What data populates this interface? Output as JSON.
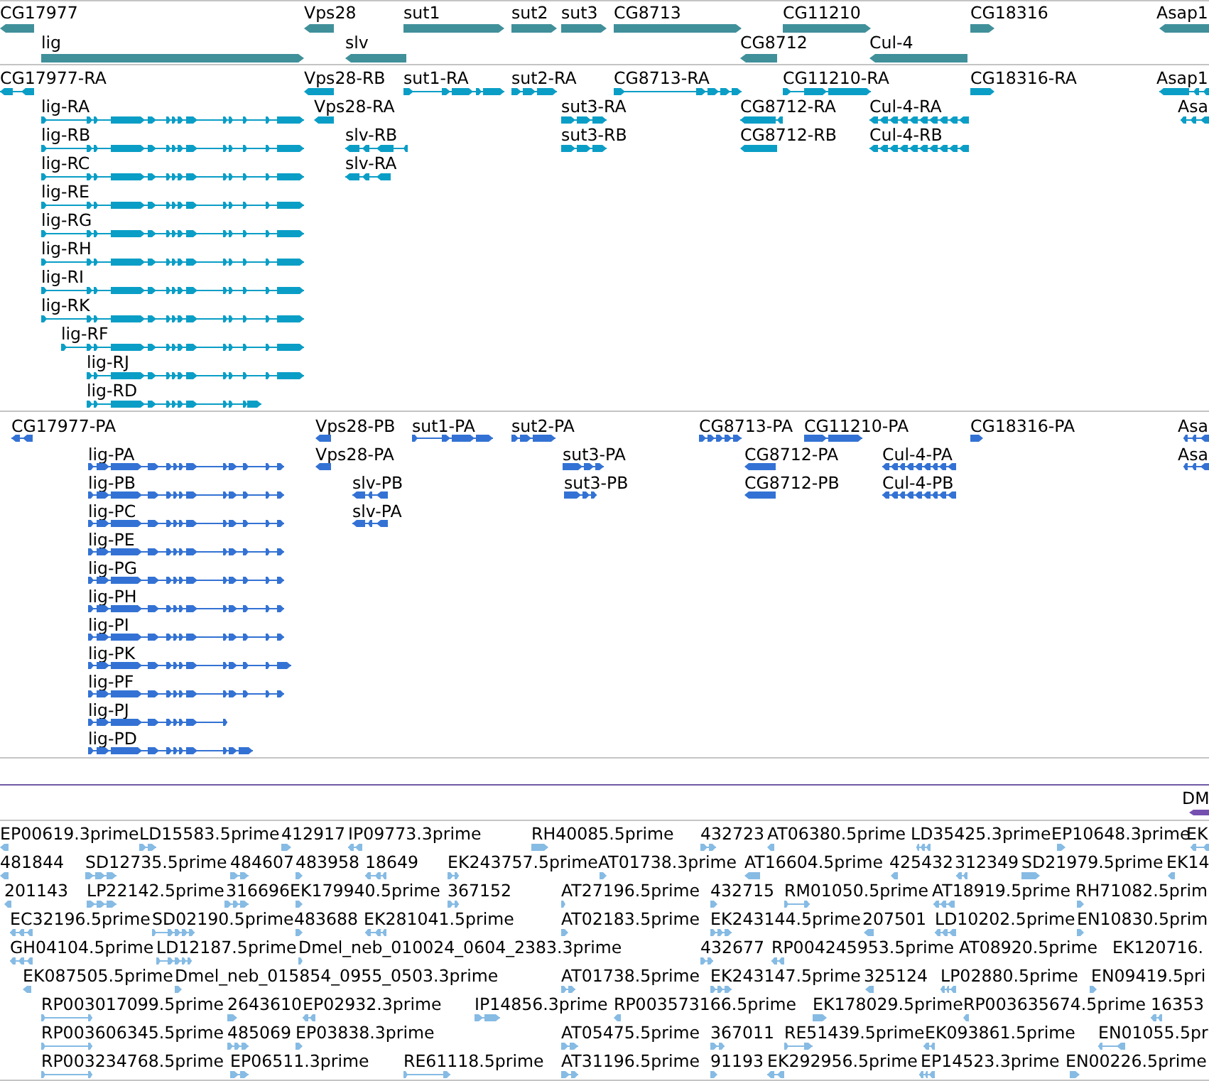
{
  "tracks": [
    {
      "kind": "gene",
      "features": [
        {
          "label": "CG17977",
          "reverse": true
        },
        {
          "label": "Vps28",
          "reverse": true
        },
        {
          "label": "sut1",
          "reverse": false
        },
        {
          "label": "sut2",
          "reverse": false
        },
        {
          "label": "sut3",
          "reverse": false
        },
        {
          "label": "CG8713",
          "reverse": false
        },
        {
          "label": "CG11210",
          "reverse": false
        },
        {
          "label": "CG18316",
          "reverse": false
        },
        {
          "label": "Asap1",
          "reverse": true
        },
        {
          "label": "lig",
          "reverse": false
        },
        {
          "label": "slv",
          "reverse": true
        },
        {
          "label": "CG8712",
          "reverse": true
        },
        {
          "label": "Cul-4",
          "reverse": true
        }
      ]
    },
    {
      "kind": "transcript",
      "features": [
        {
          "label": "CG17977-RA",
          "reverse": true
        },
        {
          "label": "Vps28-RB",
          "reverse": true
        },
        {
          "label": "sut1-RA",
          "reverse": false
        },
        {
          "label": "sut2-RA",
          "reverse": false
        },
        {
          "label": "CG8713-RA",
          "reverse": false
        },
        {
          "label": "CG11210-RA",
          "reverse": false
        },
        {
          "label": "CG18316-RA",
          "reverse": false
        },
        {
          "label": "Asap1",
          "reverse": true
        },
        {
          "label": "lig-RA",
          "reverse": false
        },
        {
          "label": "Vps28-RA",
          "reverse": true
        },
        {
          "label": "sut3-RA",
          "reverse": false
        },
        {
          "label": "CG8712-RA",
          "reverse": true
        },
        {
          "label": "Cul-4-RA",
          "reverse": true
        },
        {
          "label": "Asa",
          "reverse": true
        },
        {
          "label": "lig-RB",
          "reverse": false
        },
        {
          "label": "slv-RB",
          "reverse": true
        },
        {
          "label": "sut3-RB",
          "reverse": false
        },
        {
          "label": "CG8712-RB",
          "reverse": true
        },
        {
          "label": "Cul-4-RB",
          "reverse": true
        },
        {
          "label": "lig-RC",
          "reverse": false
        },
        {
          "label": "slv-RA",
          "reverse": true
        },
        {
          "label": "lig-RE",
          "reverse": false
        },
        {
          "label": "lig-RG",
          "reverse": false
        },
        {
          "label": "lig-RH",
          "reverse": false
        },
        {
          "label": "lig-RI",
          "reverse": false
        },
        {
          "label": "lig-RK",
          "reverse": false
        },
        {
          "label": "lig-RF",
          "reverse": false
        },
        {
          "label": "lig-RJ",
          "reverse": false
        },
        {
          "label": "lig-RD",
          "reverse": false
        }
      ]
    },
    {
      "kind": "protein",
      "features": [
        {
          "label": "CG17977-PA",
          "reverse": true
        },
        {
          "label": "Vps28-PB",
          "reverse": true
        },
        {
          "label": "sut1-PA",
          "reverse": false
        },
        {
          "label": "sut2-PA",
          "reverse": false
        },
        {
          "label": "CG8713-PA",
          "reverse": false
        },
        {
          "label": "CG11210-PA",
          "reverse": false
        },
        {
          "label": "CG18316-PA",
          "reverse": false
        },
        {
          "label": "Asa",
          "reverse": true
        },
        {
          "label": "lig-PA",
          "reverse": false
        },
        {
          "label": "Vps28-PA",
          "reverse": true
        },
        {
          "label": "sut3-PA",
          "reverse": false
        },
        {
          "label": "CG8712-PA",
          "reverse": true
        },
        {
          "label": "Cul-4-PA",
          "reverse": true
        },
        {
          "label": "Asa",
          "reverse": true
        },
        {
          "label": "lig-PB",
          "reverse": false
        },
        {
          "label": "slv-PB",
          "reverse": true
        },
        {
          "label": "sut3-PB",
          "reverse": false
        },
        {
          "label": "CG8712-PB",
          "reverse": true
        },
        {
          "label": "Cul-4-PB",
          "reverse": true
        },
        {
          "label": "lig-PC",
          "reverse": false
        },
        {
          "label": "slv-PA",
          "reverse": true
        },
        {
          "label": "lig-PE",
          "reverse": false
        },
        {
          "label": "lig-PG",
          "reverse": false
        },
        {
          "label": "lig-PH",
          "reverse": false
        },
        {
          "label": "lig-PI",
          "reverse": false
        },
        {
          "label": "lig-PK",
          "reverse": false
        },
        {
          "label": "lig-PF",
          "reverse": false
        },
        {
          "label": "lig-PJ",
          "reverse": false
        },
        {
          "label": "lig-PD",
          "reverse": false
        }
      ]
    },
    {
      "kind": "region",
      "features": [
        {
          "label": "DM",
          "reverse": true
        }
      ]
    },
    {
      "kind": "est",
      "features": [
        {
          "label": "EP00619.3prime",
          "reverse": true
        },
        {
          "label": "LD15583.5prime",
          "reverse": false
        },
        {
          "label": "412917",
          "reverse": false
        },
        {
          "label": "IP09773.3prime",
          "reverse": true
        },
        {
          "label": "RH40085.5prime",
          "reverse": false
        },
        {
          "label": "432723",
          "reverse": false
        },
        {
          "label": "AT06380.5prime",
          "reverse": true
        },
        {
          "label": "LD35425.3prime",
          "reverse": true
        },
        {
          "label": "EP10648.3prime",
          "reverse": false
        },
        {
          "label": "EK",
          "reverse": true
        },
        {
          "label": "481844",
          "reverse": true
        },
        {
          "label": "SD12735.5prime",
          "reverse": false
        },
        {
          "label": "484607",
          "reverse": false
        },
        {
          "label": "483958",
          "reverse": false
        },
        {
          "label": "18649",
          "reverse": true
        },
        {
          "label": "EK243757.5prime",
          "reverse": false
        },
        {
          "label": "AT01738.3prime",
          "reverse": false
        },
        {
          "label": "AT16604.5prime",
          "reverse": true
        },
        {
          "label": "425432",
          "reverse": true
        },
        {
          "label": "312349",
          "reverse": true
        },
        {
          "label": "SD21979.5prime",
          "reverse": false
        },
        {
          "label": "EK14",
          "reverse": true
        },
        {
          "label": "201143",
          "reverse": true
        },
        {
          "label": "LP22142.5prime",
          "reverse": false
        },
        {
          "label": "316696",
          "reverse": false
        },
        {
          "label": "EK179940.5prime",
          "reverse": false
        },
        {
          "label": "367152",
          "reverse": false
        },
        {
          "label": "AT27196.5prime",
          "reverse": false
        },
        {
          "label": "432715",
          "reverse": false
        },
        {
          "label": "RM01050.5prime",
          "reverse": false
        },
        {
          "label": "AT18919.5prime",
          "reverse": true
        },
        {
          "label": "RH71082.5prim",
          "reverse": false
        },
        {
          "label": "EC32196.5prime",
          "reverse": true
        },
        {
          "label": "SD02190.5prime",
          "reverse": false
        },
        {
          "label": "483688",
          "reverse": false
        },
        {
          "label": "EK281041.5prime",
          "reverse": true
        },
        {
          "label": "AT02183.5prime",
          "reverse": false
        },
        {
          "label": "EK243144.5prime",
          "reverse": false
        },
        {
          "label": "207501",
          "reverse": true
        },
        {
          "label": "LD10202.5prime",
          "reverse": true
        },
        {
          "label": "EN10830.5prim",
          "reverse": false
        },
        {
          "label": "GH04104.5prime",
          "reverse": true
        },
        {
          "label": "LD12187.5prime",
          "reverse": false
        },
        {
          "label": "Dmel_neb_010024_0604_2383.3prime",
          "reverse": false
        },
        {
          "label": "432677",
          "reverse": false
        },
        {
          "label": "RP004245953.5prime",
          "reverse": true
        },
        {
          "label": "AT08920.5prime"
        },
        {
          "label": "EK120716."
        },
        {
          "label": "EK087505.5prime",
          "reverse": true
        },
        {
          "label": "Dmel_neb_015854_0955_0503.3prime",
          "reverse": false
        },
        {
          "label": "AT01738.5prime",
          "reverse": false
        },
        {
          "label": "EK243147.5prime",
          "reverse": false
        },
        {
          "label": "325124",
          "reverse": true
        },
        {
          "label": "LP02880.5prime",
          "reverse": true
        },
        {
          "label": "EN09419.5pri",
          "reverse": false
        },
        {
          "label": "RP003017099.5prime",
          "reverse": false
        },
        {
          "label": "2643610",
          "reverse": false
        },
        {
          "label": "EP02932.3prime",
          "reverse": true
        },
        {
          "label": "IP14856.3prime",
          "reverse": false
        },
        {
          "label": "RP003573166.5prime",
          "reverse": true
        },
        {
          "label": "EK178029.5prime",
          "reverse": false
        },
        {
          "label": "RP003635674.5prime",
          "reverse": true
        },
        {
          "label": "16353",
          "reverse": true
        },
        {
          "label": "RP003606345.5prime",
          "reverse": false
        },
        {
          "label": "485069",
          "reverse": false
        },
        {
          "label": "EP03838.3prime",
          "reverse": false
        },
        {
          "label": "AT05475.5prime",
          "reverse": false
        },
        {
          "label": "367011",
          "reverse": false
        },
        {
          "label": "RE51439.5prime",
          "reverse": false
        },
        {
          "label": "EK093861.5prime",
          "reverse": true
        },
        {
          "label": "EN01055.5pr",
          "reverse": true
        },
        {
          "label": "RP003234768.5prime",
          "reverse": false
        },
        {
          "label": "EP06511.3prime",
          "reverse": false
        },
        {
          "label": "RE61118.5prime",
          "reverse": false
        },
        {
          "label": "AT31196.5prime",
          "reverse": false
        },
        {
          "label": "91193",
          "reverse": false
        },
        {
          "label": "EK292956.5prime",
          "reverse": true
        },
        {
          "label": "EP14523.3prime",
          "reverse": true
        },
        {
          "label": "EN00226.5prime",
          "reverse": false
        }
      ]
    }
  ]
}
